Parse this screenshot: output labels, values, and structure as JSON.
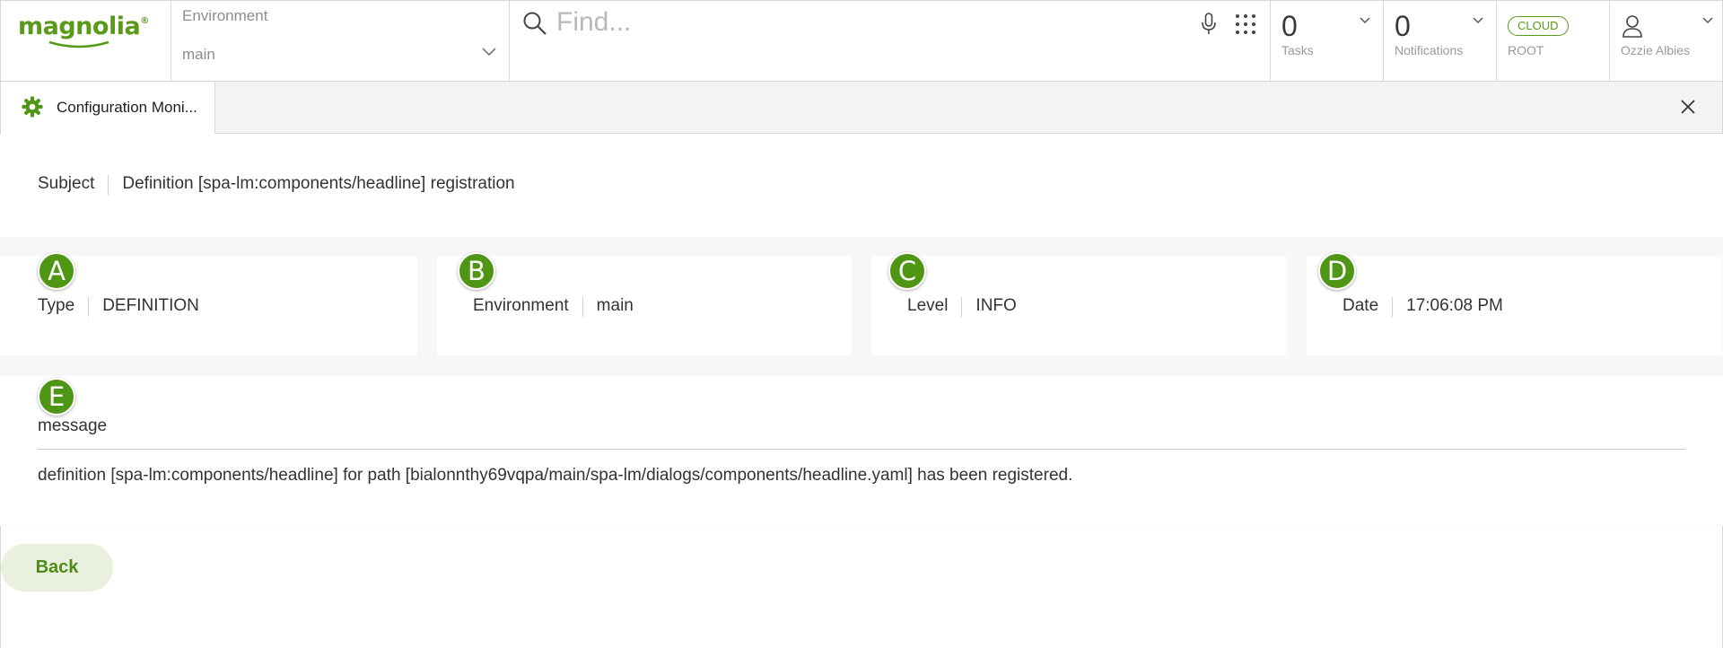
{
  "brand": {
    "logo_text": "magnolia",
    "trademark": "®",
    "accent": "#599a18",
    "marker_color": "#4f9615"
  },
  "header": {
    "environment": {
      "label": "Environment",
      "value": "main"
    },
    "search": {
      "placeholder": "Find..."
    },
    "tasks": {
      "count": "0",
      "label": "Tasks"
    },
    "notifications": {
      "count": "0",
      "label": "Notifications"
    },
    "cloud": {
      "badge": "CLOUD",
      "label": "ROOT"
    },
    "user": {
      "name": "Ozzie Albies"
    }
  },
  "tab": {
    "label": "Configuration Moni..."
  },
  "detail": {
    "subject": {
      "label": "Subject",
      "value": "Definition [spa-lm:components/headline] registration"
    },
    "type": {
      "marker": "A",
      "label": "Type",
      "value": "DEFINITION"
    },
    "environment": {
      "marker": "B",
      "label": "Environment",
      "value": "main"
    },
    "level": {
      "marker": "C",
      "label": "Level",
      "value": "INFO"
    },
    "date": {
      "marker": "D",
      "label": "Date",
      "value": "17:06:08 PM"
    },
    "message": {
      "marker": "E",
      "label": "message",
      "text": "definition [spa-lm:components/headline] for path [bialonnthy69vqpa/main/spa-lm/dialogs/components/headline.yaml] has been registered."
    }
  },
  "actions": {
    "back_label": "Back"
  }
}
